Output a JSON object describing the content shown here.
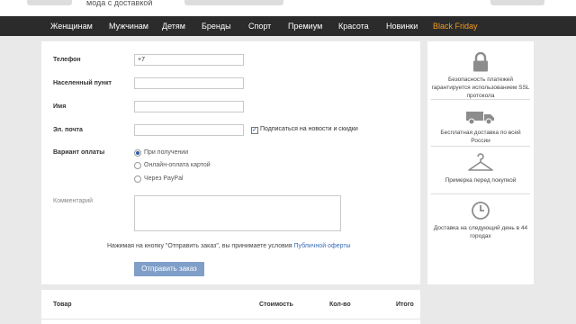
{
  "header": {
    "tagline": "мода с доставкой"
  },
  "nav": {
    "items": [
      "Женщинам",
      "Мужчинам",
      "Детям",
      "Бренды",
      "Спорт",
      "Премиум",
      "Красота",
      "Новинки",
      "Black Friday"
    ],
    "highlight_color": "#f39b1f"
  },
  "form": {
    "phone": {
      "label": "Телефон",
      "value": "+7"
    },
    "city": {
      "label": "Населенный пункт",
      "value": ""
    },
    "name": {
      "label": "Имя",
      "value": ""
    },
    "email": {
      "label": "Эл. почта",
      "value": ""
    },
    "subscribe": {
      "label": "Подписаться на новости и скидки",
      "checked": true
    },
    "payment": {
      "label": "Вариант оплаты",
      "options": [
        "При получении",
        "Онлайн-оплата картой",
        "Через PayPal"
      ],
      "selected": 0
    },
    "comment": {
      "label": "Комментарий",
      "value": ""
    },
    "agreement": {
      "text": "Нажимая на кнопку \"Отправить заказ\", вы принимаете условия ",
      "link": "Публичной оферты"
    },
    "submit_label": "Отправить заказ",
    "submit_color": "#7f9ec8"
  },
  "table": {
    "headers": [
      "Товар",
      "Стоимость",
      "Кол-во",
      "Итого"
    ]
  },
  "benefits": [
    {
      "icon": "lock-icon",
      "text": "Безопасность платежей гарантируется использованием SSL протокола"
    },
    {
      "icon": "delivery-truck-icon",
      "text": "Бесплатная доставка по всей России"
    },
    {
      "icon": "hanger-icon",
      "text": "Примерка перед покупкой"
    },
    {
      "icon": "clock-icon",
      "text": "Доставка на следующий день в 44 городах"
    }
  ]
}
